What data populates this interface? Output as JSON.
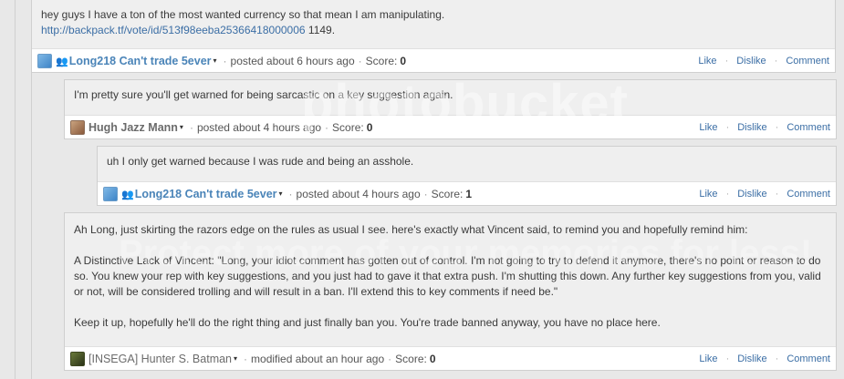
{
  "actions": {
    "like": "Like",
    "dislike": "Dislike",
    "comment": "Comment"
  },
  "separator": "·",
  "caret": "▾",
  "comments": [
    {
      "text1": "hey guys I have a ton of the most wanted currency so that mean I am manipulating.",
      "link": "http://backpack.tf/vote/id/513f98eeba25366418000006",
      "link_suffix": "1149.",
      "user": "Long218 Can't trade 5ever",
      "posted": "posted about 6 hours ago",
      "score_label": "Score:",
      "score": "0"
    },
    {
      "text1": "I'm pretty sure you'll get warned for being sarcastic on a key suggestion again.",
      "user": "Hugh Jazz Mann",
      "posted": "posted about 4 hours ago",
      "score_label": "Score:",
      "score": "0"
    },
    {
      "text1": "uh I only get warned because I was rude and being an asshole.",
      "user": "Long218 Can't trade 5ever",
      "posted": "posted about 4 hours ago",
      "score_label": "Score:",
      "score": "1"
    },
    {
      "text1": "Ah Long, just skirting the razors edge on the rules as usual I see. here's exactly what Vincent said, to remind you and hopefully remind him:",
      "text2": "A Distinctive Lack of Vincent: \"Long, your idiot comment has gotten out of control. I'm not going to try to defend it anymore, there's no point or reason to do so. You knew your rep with key suggestions, and you just had to gave it that extra push. I'm shutting this down. Any further key suggestions from you, valid or not, will be considered trolling and will result in a ban. I'll extend this to key comments if need be.\"",
      "text3": "Keep it up, hopefully he'll do the right thing and just finally ban you. You're trade banned anyway, you have no place here.",
      "user": "[INSEGA] Hunter S. Batman",
      "posted": "modified about an hour ago",
      "score_label": "Score:",
      "score": "0"
    }
  ],
  "watermark": {
    "brand": "photobucket",
    "tagline": "Protect more of your memories for less!"
  }
}
